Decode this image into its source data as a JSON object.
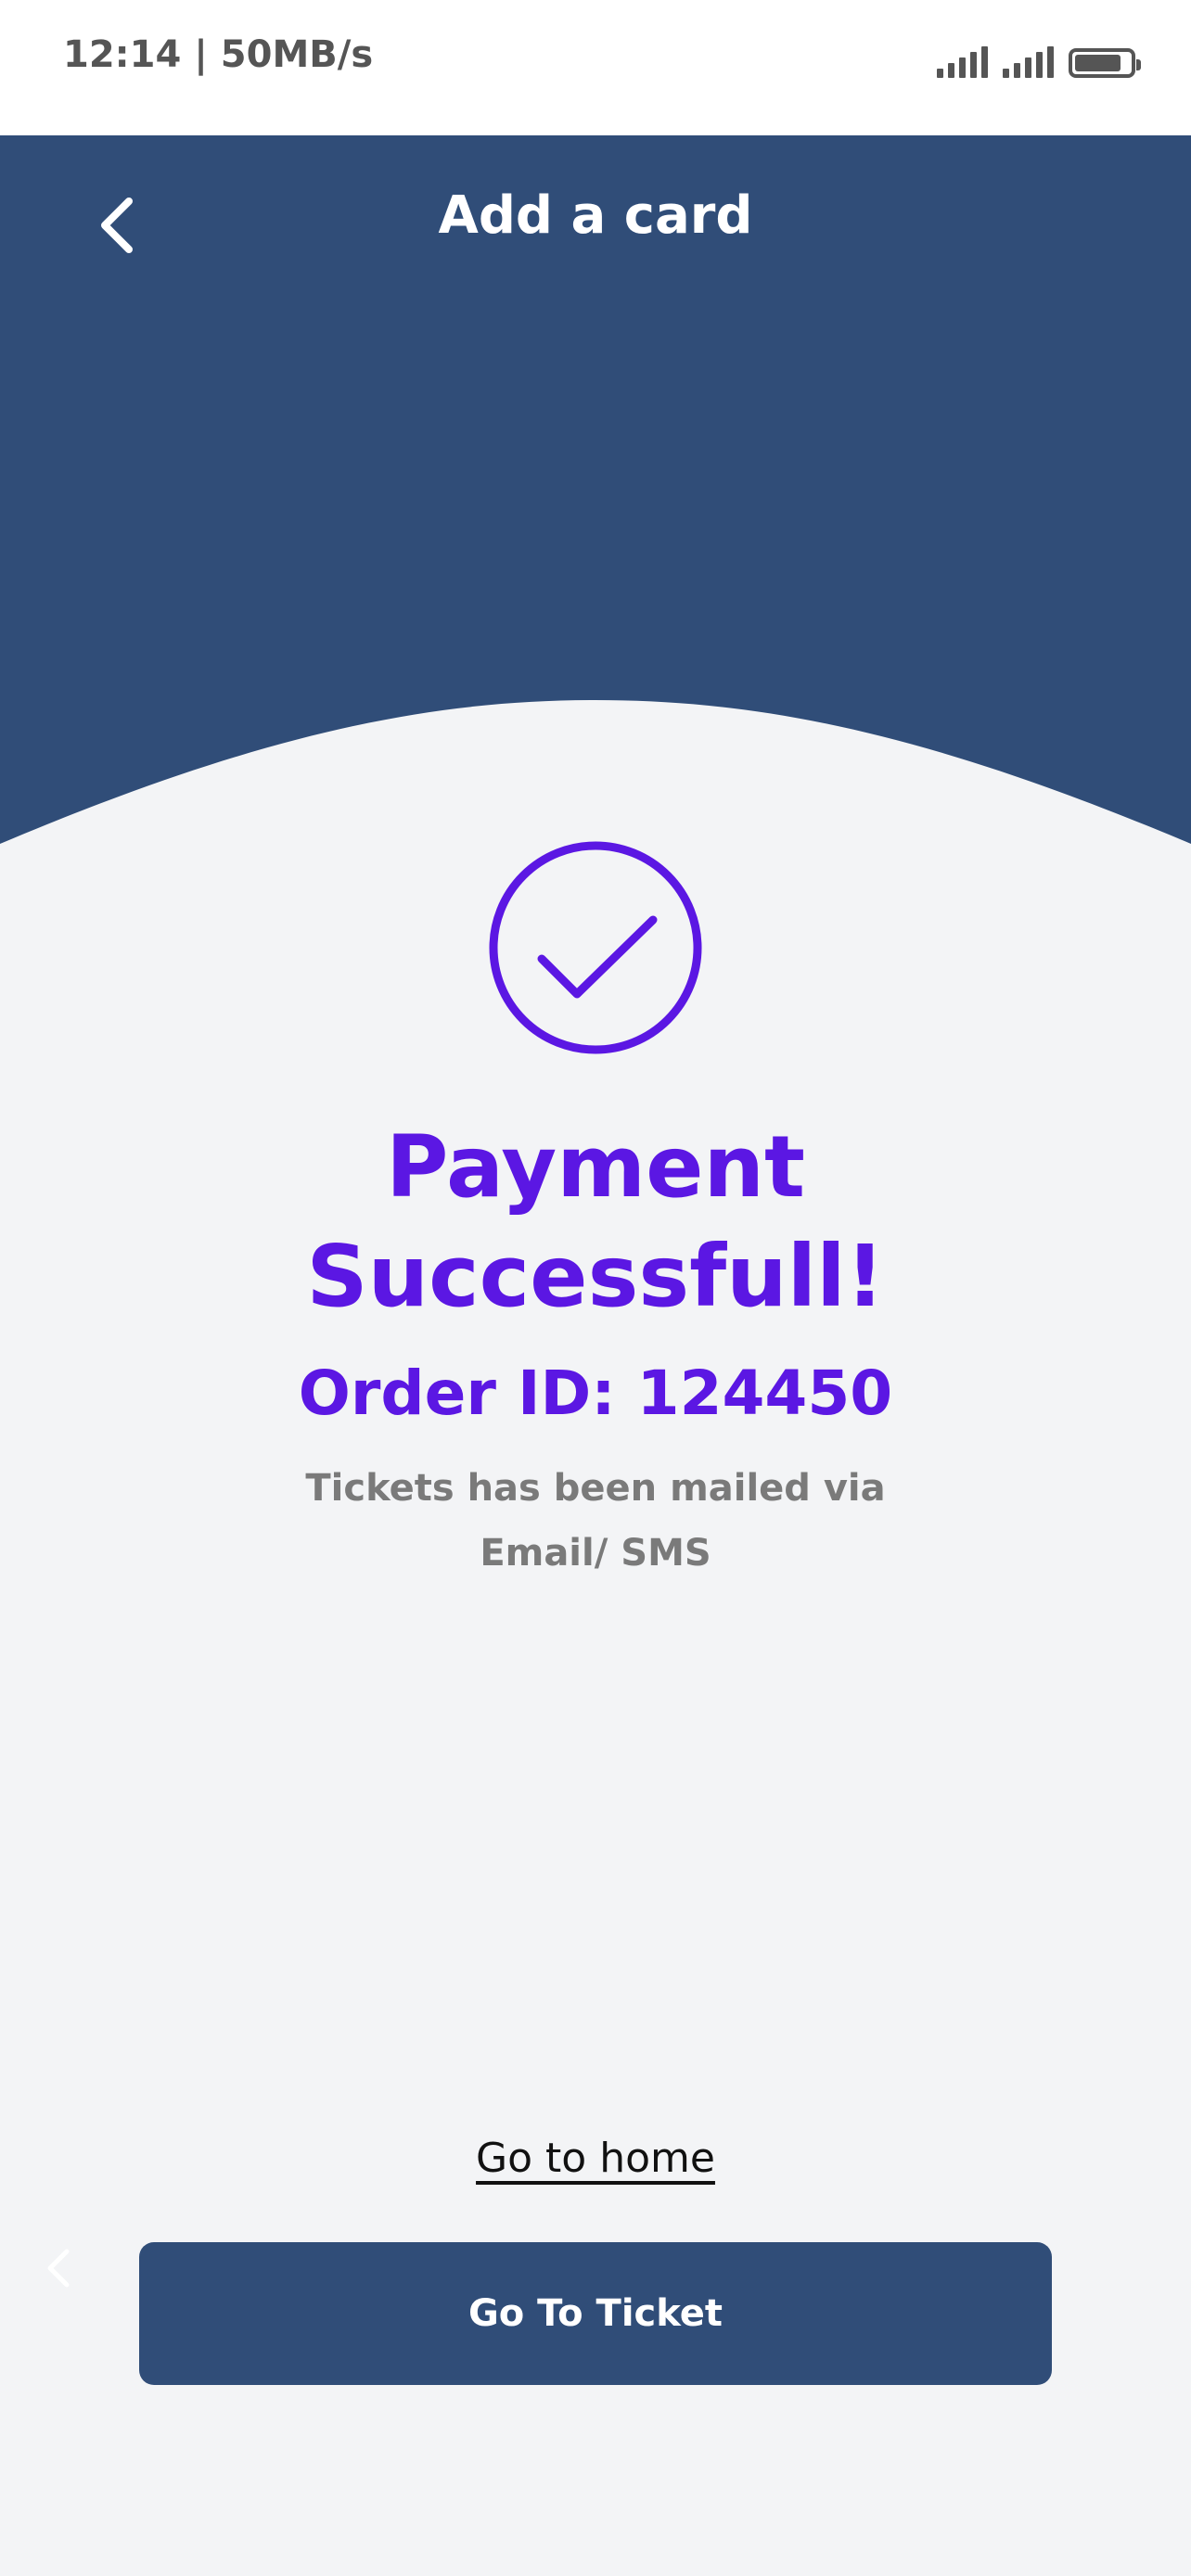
{
  "status_bar": {
    "time": "12:14 | 50MB/s",
    "signal_icon": "signal-bars-icon",
    "battery_icon": "battery-icon"
  },
  "header": {
    "title": "Add a card",
    "back_icon": "chevron-left-icon",
    "background_color": "#304d78"
  },
  "success": {
    "icon": "check-circle-icon",
    "title_line1": "Payment",
    "title_line2": "Successfull!",
    "order_id": "Order ID: 124450",
    "message_line1": "Tickets has been mailed via",
    "message_line2": "Email/ SMS",
    "accent_color": "#5b17e3"
  },
  "actions": {
    "home_link": "Go to home",
    "ticket_button": "Go To Ticket",
    "button_color": "#304d78"
  },
  "page": {
    "background_color": "#f3f4f6"
  }
}
